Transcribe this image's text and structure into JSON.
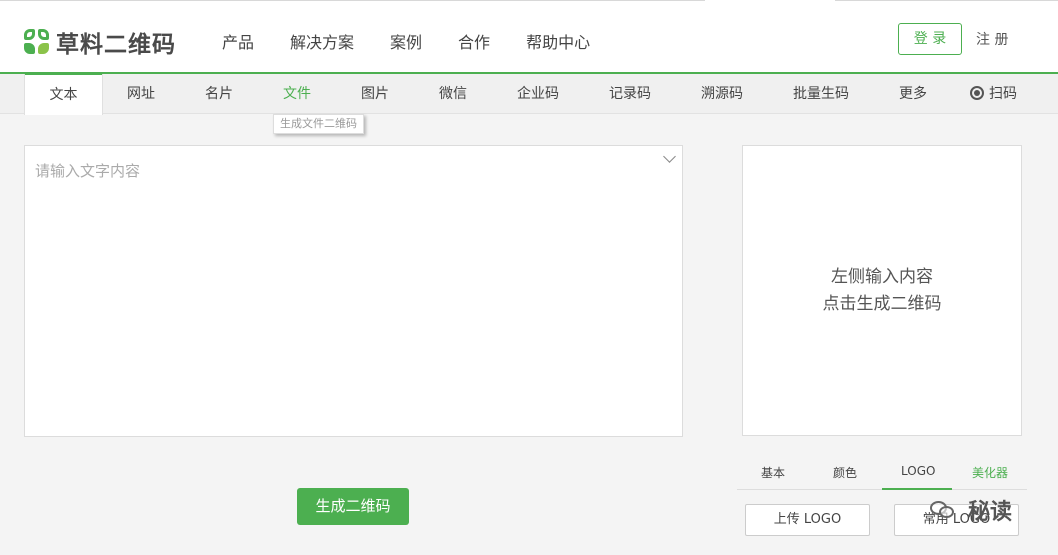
{
  "header": {
    "logo_text": "草料二维码",
    "nav": [
      "产品",
      "解决方案",
      "案例",
      "合作",
      "帮助中心"
    ],
    "login_label": "登 录",
    "register_label": "注 册"
  },
  "tabs": {
    "items": [
      "文本",
      "网址",
      "名片",
      "文件",
      "图片",
      "微信",
      "企业码",
      "记录码",
      "溯源码",
      "批量生码",
      "更多",
      "扫码"
    ],
    "active": "文本",
    "hovered": "文件",
    "tooltip": "生成文件二维码"
  },
  "editor": {
    "placeholder": "请输入文字内容"
  },
  "generate_label": "生成二维码",
  "preview": {
    "line1": "左侧输入内容",
    "line2": "点击生成二维码"
  },
  "style_tabs": {
    "items": [
      "基本",
      "颜色",
      "LOGO",
      "美化器"
    ],
    "active": "LOGO"
  },
  "logo_buttons": {
    "upload": "上传 LOGO",
    "common": "常用 LOGO"
  },
  "watermark": {
    "text": "秘读"
  },
  "colors": {
    "brand": "#4caf50"
  }
}
